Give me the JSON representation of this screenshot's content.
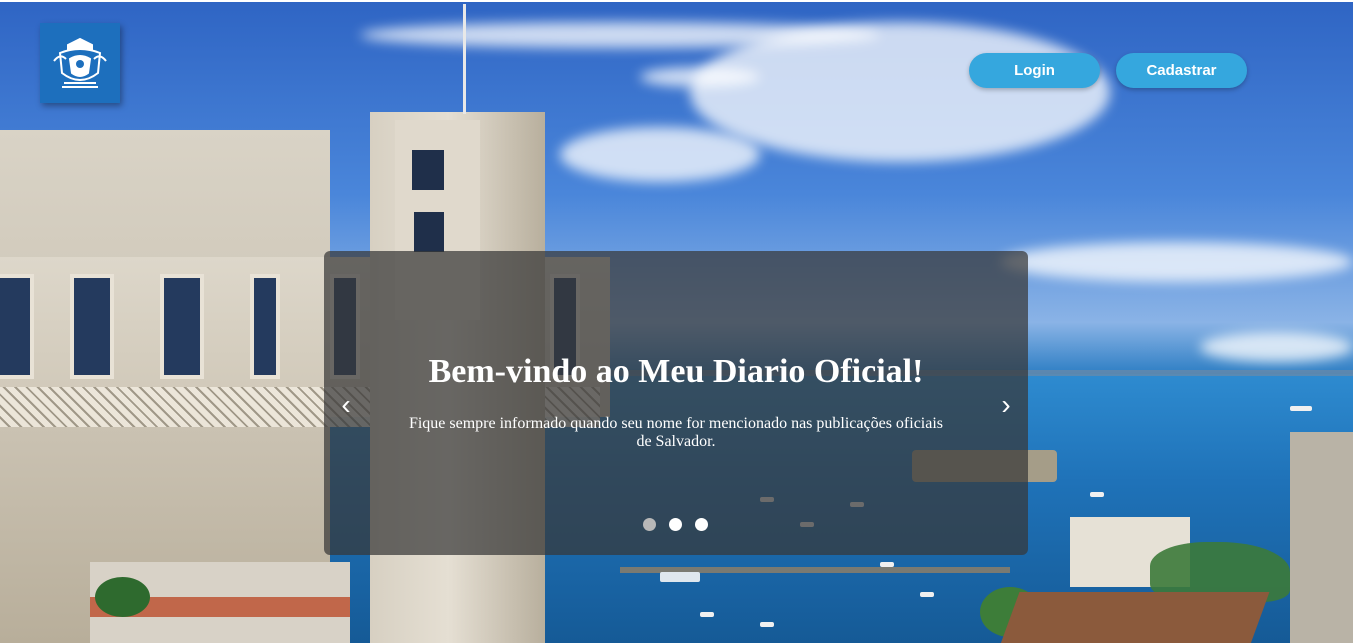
{
  "header": {
    "logo_icon": "city-coat-of-arms-icon",
    "login_label": "Login",
    "register_label": "Cadastrar",
    "button_color": "#35a7de"
  },
  "carousel": {
    "title": "Bem-vindo ao Meu Diario Oficial!",
    "subtitle": "Fique sempre informado quando seu nome for mencionado nas publicações oficiais de Salvador.",
    "prev_icon": "chevron-left-icon",
    "next_icon": "chevron-right-icon",
    "prev_glyph": "‹",
    "next_glyph": "›",
    "slide_count": 3,
    "active_slide": 1
  }
}
